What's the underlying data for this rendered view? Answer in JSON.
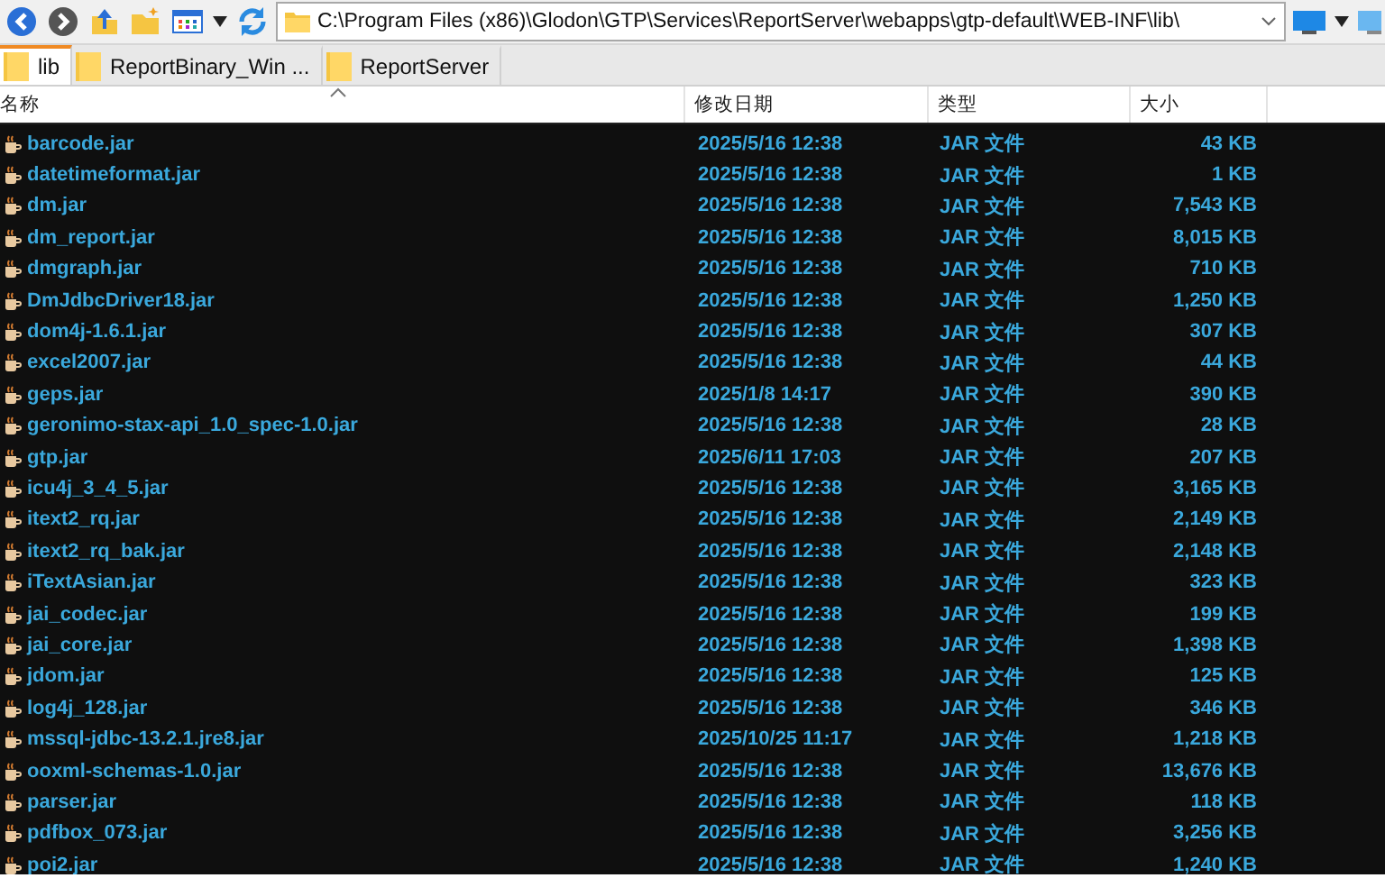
{
  "address_bar": {
    "path": "C:\\Program Files (x86)\\Glodon\\GTP\\Services\\ReportServer\\webapps\\gtp-default\\WEB-INF\\lib\\"
  },
  "tabs": [
    {
      "label": "lib",
      "selected": true
    },
    {
      "label": "ReportBinary_Win ...",
      "selected": false
    },
    {
      "label": "ReportServer",
      "selected": false
    }
  ],
  "table": {
    "columns": [
      "名称",
      "修改日期",
      "类型",
      "大小"
    ],
    "rows": [
      {
        "name": "barcode.jar",
        "date": "2025/5/16 12:38",
        "type": "JAR 文件",
        "size": "43 KB"
      },
      {
        "name": "datetimeformat.jar",
        "date": "2025/5/16 12:38",
        "type": "JAR 文件",
        "size": "1 KB"
      },
      {
        "name": "dm.jar",
        "date": "2025/5/16 12:38",
        "type": "JAR 文件",
        "size": "7,543 KB"
      },
      {
        "name": "dm_report.jar",
        "date": "2025/5/16 12:38",
        "type": "JAR 文件",
        "size": "8,015 KB"
      },
      {
        "name": "dmgraph.jar",
        "date": "2025/5/16 12:38",
        "type": "JAR 文件",
        "size": "710 KB"
      },
      {
        "name": "DmJdbcDriver18.jar",
        "date": "2025/5/16 12:38",
        "type": "JAR 文件",
        "size": "1,250 KB"
      },
      {
        "name": "dom4j-1.6.1.jar",
        "date": "2025/5/16 12:38",
        "type": "JAR 文件",
        "size": "307 KB"
      },
      {
        "name": "excel2007.jar",
        "date": "2025/5/16 12:38",
        "type": "JAR 文件",
        "size": "44 KB"
      },
      {
        "name": "geps.jar",
        "date": "2025/1/8 14:17",
        "type": "JAR 文件",
        "size": "390 KB"
      },
      {
        "name": "geronimo-stax-api_1.0_spec-1.0.jar",
        "date": "2025/5/16 12:38",
        "type": "JAR 文件",
        "size": "28 KB"
      },
      {
        "name": "gtp.jar",
        "date": "2025/6/11 17:03",
        "type": "JAR 文件",
        "size": "207 KB"
      },
      {
        "name": "icu4j_3_4_5.jar",
        "date": "2025/5/16 12:38",
        "type": "JAR 文件",
        "size": "3,165 KB"
      },
      {
        "name": "itext2_rq.jar",
        "date": "2025/5/16 12:38",
        "type": "JAR 文件",
        "size": "2,149 KB"
      },
      {
        "name": "itext2_rq_bak.jar",
        "date": "2025/5/16 12:38",
        "type": "JAR 文件",
        "size": "2,148 KB"
      },
      {
        "name": "iTextAsian.jar",
        "date": "2025/5/16 12:38",
        "type": "JAR 文件",
        "size": "323 KB"
      },
      {
        "name": "jai_codec.jar",
        "date": "2025/5/16 12:38",
        "type": "JAR 文件",
        "size": "199 KB"
      },
      {
        "name": "jai_core.jar",
        "date": "2025/5/16 12:38",
        "type": "JAR 文件",
        "size": "1,398 KB"
      },
      {
        "name": "jdom.jar",
        "date": "2025/5/16 12:38",
        "type": "JAR 文件",
        "size": "125 KB"
      },
      {
        "name": "log4j_128.jar",
        "date": "2025/5/16 12:38",
        "type": "JAR 文件",
        "size": "346 KB"
      },
      {
        "name": "mssql-jdbc-13.2.1.jre8.jar",
        "date": "2025/10/25 11:17",
        "type": "JAR 文件",
        "size": "1,218 KB"
      },
      {
        "name": "ooxml-schemas-1.0.jar",
        "date": "2025/5/16 12:38",
        "type": "JAR 文件",
        "size": "13,676 KB"
      },
      {
        "name": "parser.jar",
        "date": "2025/5/16 12:38",
        "type": "JAR 文件",
        "size": "118 KB"
      },
      {
        "name": "pdfbox_073.jar",
        "date": "2025/5/16 12:38",
        "type": "JAR 文件",
        "size": "3,256 KB"
      },
      {
        "name": "poi2.jar",
        "date": "2025/5/16 12:38",
        "type": "JAR 文件",
        "size": "1,240 KB"
      }
    ]
  }
}
